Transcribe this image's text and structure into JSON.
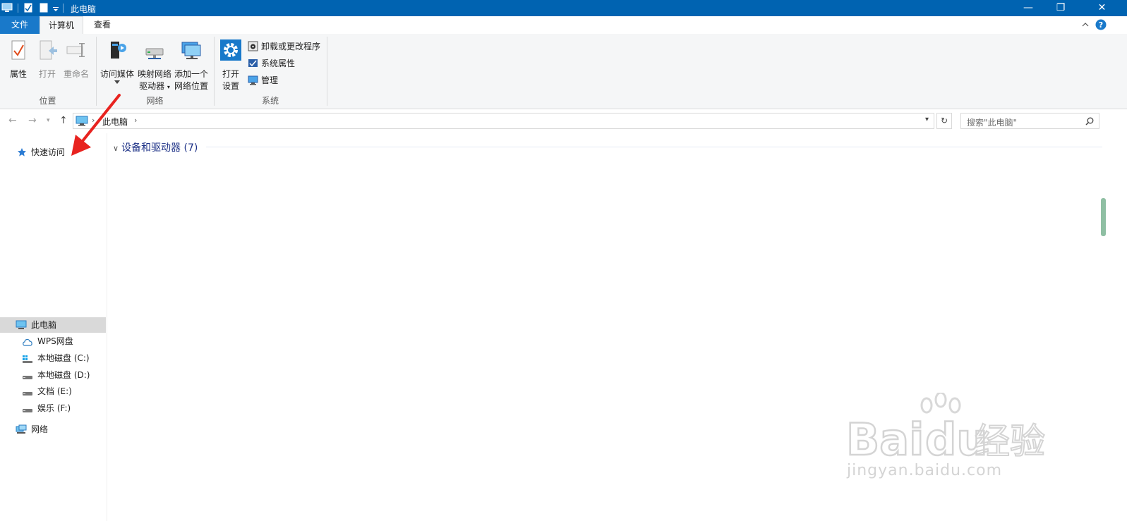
{
  "window": {
    "title": "此电脑",
    "controls": {
      "minimize": "—",
      "restore": "❐",
      "close": "✕"
    }
  },
  "tabs": {
    "file": "文件",
    "computer": "计算机",
    "view": "查看"
  },
  "ribbon": {
    "location": {
      "properties": "属性",
      "open": "打开",
      "rename": "重命名",
      "group_label": "位置"
    },
    "network": {
      "access_media": "访问媒体",
      "map_drive_line1": "映射网络",
      "map_drive_line2": "驱动器",
      "add_location_line1": "添加一个",
      "add_location_line2": "网络位置",
      "group_label": "网络"
    },
    "system": {
      "open_settings_line1": "打开",
      "open_settings_line2": "设置",
      "uninstall": "卸载或更改程序",
      "system_properties": "系统属性",
      "manage": "管理",
      "group_label": "系统"
    }
  },
  "address": {
    "path": "此电脑",
    "search_placeholder": "搜索\"此电脑\""
  },
  "navpane": {
    "quick_access": "快速访问",
    "this_pc": "此电脑",
    "wps_cloud": "WPS网盘",
    "drive_c": "本地磁盘 (C:)",
    "drive_d": "本地磁盘 (D:)",
    "drive_e": "文档 (E:)",
    "drive_f": "娱乐 (F:)",
    "network": "网络"
  },
  "content": {
    "group_header": "设备和驱动器 (7)"
  },
  "watermark": {
    "brand": "Baidu经验",
    "url": "jingyan.baidu.com"
  },
  "colors": {
    "titlebar": "#0063b1",
    "file_tab": "#1979ca",
    "annotation_arrow": "#e8231f",
    "group_header_text": "#1e3287"
  }
}
